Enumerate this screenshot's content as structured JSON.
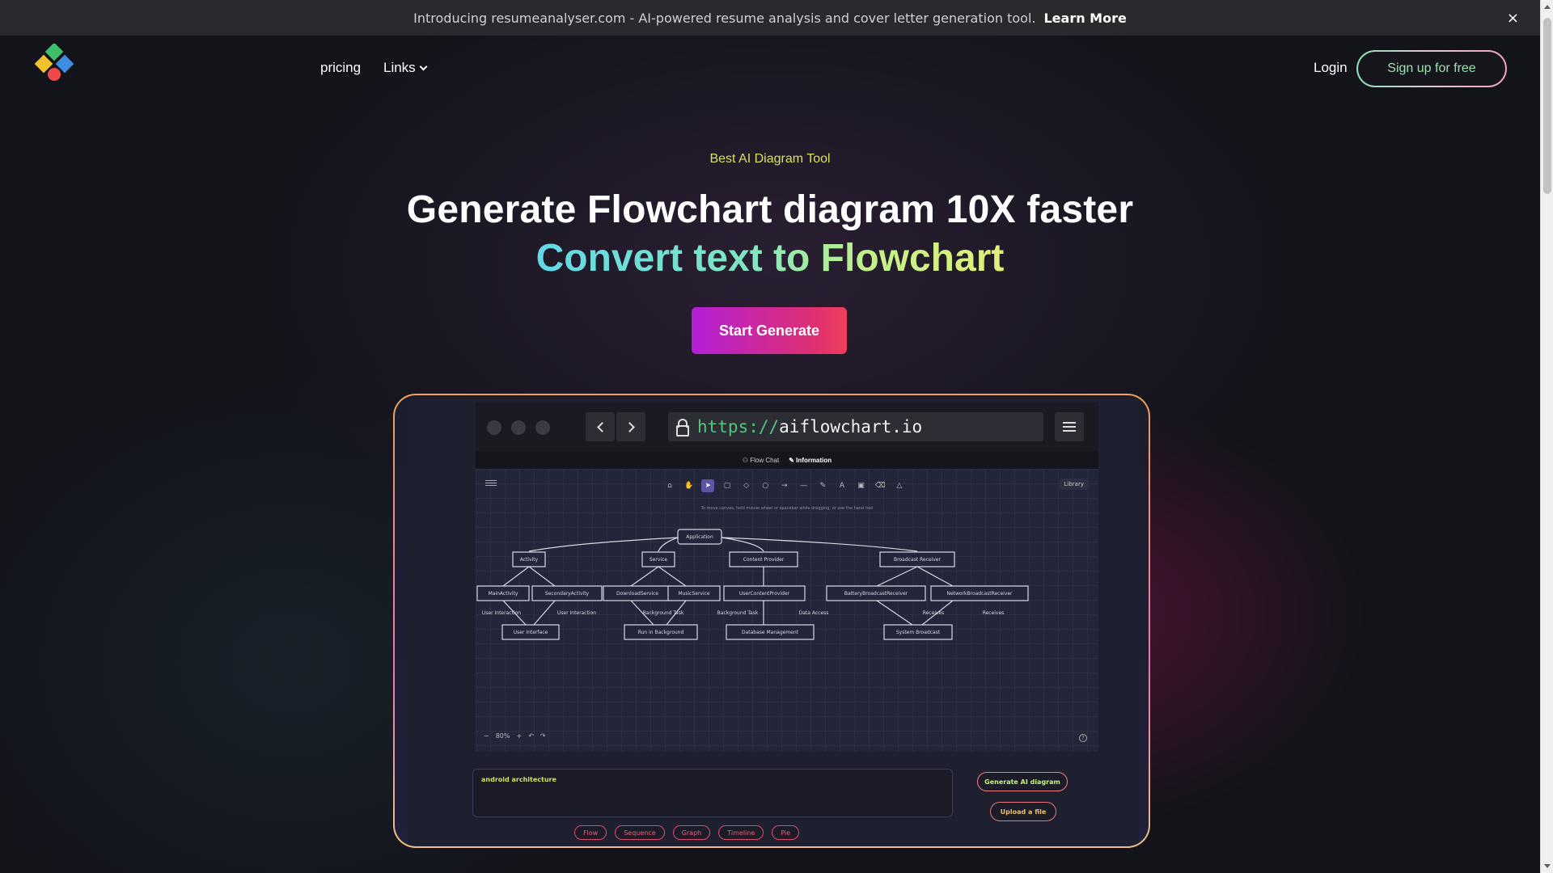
{
  "banner": {
    "text": "Introducing resumeanalyser.com - AI-powered resume analysis and cover letter generation tool.",
    "link": "Learn More",
    "close": "×"
  },
  "nav": {
    "pricing": "pricing",
    "links": "Links",
    "login": "Login",
    "signup": "Sign up for free"
  },
  "hero": {
    "eyebrow": "Best AI Diagram Tool",
    "headline": "Generate Flowchart diagram 10X faster",
    "subline": "Convert text to Flowchart",
    "cta": "Start Generate"
  },
  "demo": {
    "url_proto": "https://",
    "url_host": "aiflowchart.io",
    "tabs": [
      "Flow Chat",
      "Information"
    ],
    "library": "Library",
    "hint": "To move canvas, hold mouse wheel or spacebar while dragging, or use the hand tool",
    "zoom_level": "80%",
    "diagram": {
      "root": "Application",
      "level1": [
        "Activity",
        "Service",
        "Content Provider",
        "Broadcast Receiver"
      ],
      "level2": [
        "MainActivity",
        "SecondaryActivity",
        "DownloadService",
        "MusicService",
        "UserContentProvider",
        "BatteryBroadcastReceiver",
        "NetworkBroadcastReceiver"
      ],
      "edge_labels": [
        "User Interaction",
        "User Interaction",
        "Background Task",
        "Background Task",
        "Data Access",
        "Receives",
        "Receives"
      ],
      "level3": [
        "User Interface",
        "Run in Background",
        "Database Management",
        "System Broadcast"
      ]
    },
    "prompt": "android architecture",
    "generate_btn": "Generate AI diagram",
    "upload_btn": "Upload a file",
    "chips": [
      "Flow",
      "Sequence",
      "Graph",
      "Timeline",
      "Pie"
    ]
  },
  "colors": {
    "accent_yellow": "#d9e35a",
    "cta_start": "#b41fd8",
    "cta_end": "#ef3f5d",
    "gradient_teal": "#63d8e8",
    "gradient_lime": "#e2ef7a"
  }
}
